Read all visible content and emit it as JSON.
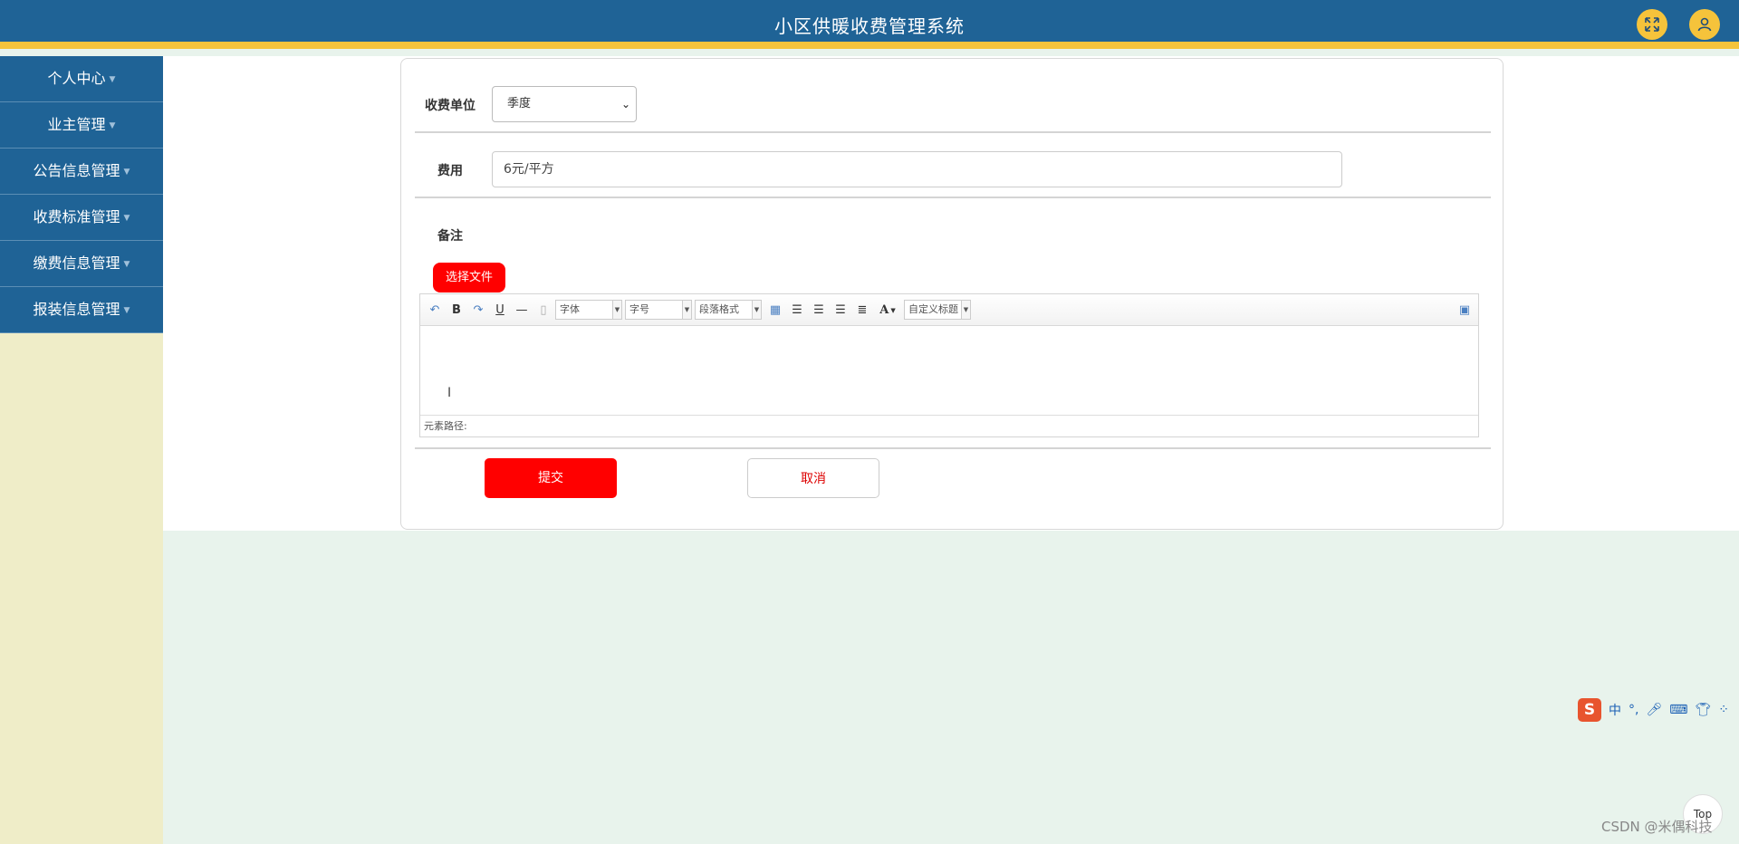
{
  "header": {
    "title": "小区供暖收费管理系统"
  },
  "sidebar": {
    "items": [
      {
        "label": "个人中心"
      },
      {
        "label": "业主管理"
      },
      {
        "label": "公告信息管理"
      },
      {
        "label": "收费标准管理"
      },
      {
        "label": "缴费信息管理"
      },
      {
        "label": "报装信息管理"
      }
    ]
  },
  "form": {
    "unit_label": "收费单位",
    "unit_value": "季度",
    "fee_label": "费用",
    "fee_value": "6元/平方",
    "remark_label": "备注",
    "file_button": "选择文件",
    "submit_label": "提交",
    "cancel_label": "取消"
  },
  "editor": {
    "toolbar": {
      "font_combo": "字体",
      "size_combo": "字号",
      "paragraph_combo": "段落格式",
      "font_color": "A",
      "custom_title_combo": "自定义标题",
      "bold": "B",
      "underline": "U"
    },
    "path_label": "元素路径:"
  },
  "ime": {
    "label": "中"
  },
  "back_to_top": "Top",
  "watermark": "CSDN @米偶科技"
}
